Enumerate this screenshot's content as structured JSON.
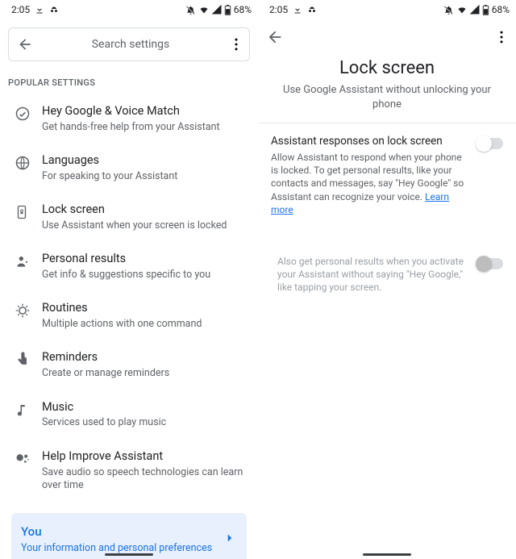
{
  "status": {
    "time": "2:05",
    "battery": "68%"
  },
  "left": {
    "search_placeholder": "Search settings",
    "section": "POPULAR SETTINGS",
    "items": [
      {
        "title": "Hey Google & Voice Match",
        "sub": "Get hands-free help from your Assistant"
      },
      {
        "title": "Languages",
        "sub": "For speaking to your Assistant"
      },
      {
        "title": "Lock screen",
        "sub": "Use Assistant when your screen is locked"
      },
      {
        "title": "Personal results",
        "sub": "Get info & suggestions specific to you"
      },
      {
        "title": "Routines",
        "sub": "Multiple actions with one command"
      },
      {
        "title": "Reminders",
        "sub": "Create or manage reminders"
      },
      {
        "title": "Music",
        "sub": "Services used to play music"
      },
      {
        "title": "Help Improve Assistant",
        "sub": "Save audio so speech technologies can learn over time"
      }
    ],
    "you": {
      "title": "You",
      "sub": "Your information and personal preferences"
    }
  },
  "right": {
    "title": "Lock screen",
    "subtitle": "Use Google Assistant without unlocking your phone",
    "s1": {
      "header": "Assistant responses on lock screen",
      "desc_pre": "Allow Assistant to respond when your phone is locked. To get personal results, like your contacts and messages, say \"Hey Google\" so Assistant can recognize your voice. ",
      "link": "Learn more"
    },
    "s2": {
      "desc": "Also get personal results when you activate your Assistant without saying \"Hey Google,\" like tapping your screen."
    }
  }
}
